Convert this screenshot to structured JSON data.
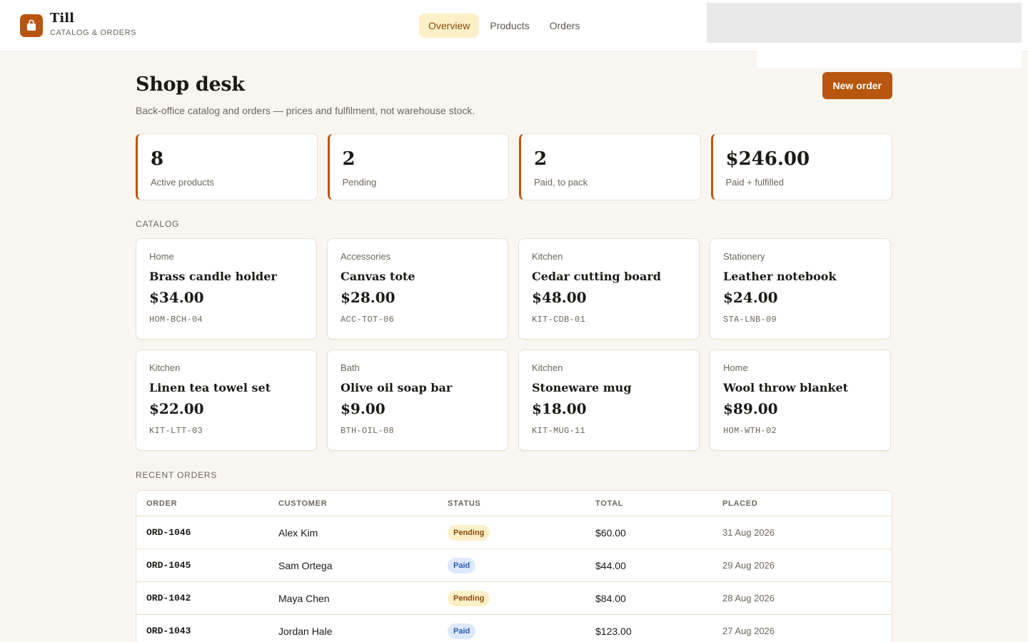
{
  "app": {
    "name": "Till",
    "subtitle": "CATALOG & ORDERS",
    "accent_color": "#b8560f",
    "logo_icon": "shopping-bag-icon"
  },
  "nav": {
    "items": [
      {
        "label": "Overview",
        "active": true
      },
      {
        "label": "Products",
        "active": false
      },
      {
        "label": "Orders",
        "active": false
      }
    ]
  },
  "page": {
    "title": "Shop desk",
    "subtitle": "Back-office catalog and orders — prices and fulfilment, not warehouse stock.",
    "new_order_label": "New order"
  },
  "stats": [
    {
      "value": "8",
      "label": "Active products"
    },
    {
      "value": "2",
      "label": "Pending"
    },
    {
      "value": "2",
      "label": "Paid, to pack"
    },
    {
      "value": "$246.00",
      "label": "Paid + fulfilled"
    }
  ],
  "catalog": {
    "label": "CATALOG",
    "products": [
      {
        "category": "Home",
        "name": "Brass candle holder",
        "price": "$34.00",
        "sku": "HOM-BCH-04"
      },
      {
        "category": "Accessories",
        "name": "Canvas tote",
        "price": "$28.00",
        "sku": "ACC-TOT-06"
      },
      {
        "category": "Kitchen",
        "name": "Cedar cutting board",
        "price": "$48.00",
        "sku": "KIT-CDB-01"
      },
      {
        "category": "Stationery",
        "name": "Leather notebook",
        "price": "$24.00",
        "sku": "STA-LNB-09"
      },
      {
        "category": "Kitchen",
        "name": "Linen tea towel set",
        "price": "$22.00",
        "sku": "KIT-LTT-03"
      },
      {
        "category": "Bath",
        "name": "Olive oil soap bar",
        "price": "$9.00",
        "sku": "BTH-OIL-08"
      },
      {
        "category": "Kitchen",
        "name": "Stoneware mug",
        "price": "$18.00",
        "sku": "KIT-MUG-11"
      },
      {
        "category": "Home",
        "name": "Wool throw blanket",
        "price": "$89.00",
        "sku": "HOM-WTH-02"
      }
    ]
  },
  "orders": {
    "label": "RECENT ORDERS",
    "columns": [
      "ORDER",
      "CUSTOMER",
      "STATUS",
      "TOTAL",
      "PLACED"
    ],
    "rows": [
      {
        "id": "ORD-1046",
        "customer": "Alex Kim",
        "status": "Pending",
        "total": "$60.00",
        "placed": "31 Aug 2026"
      },
      {
        "id": "ORD-1045",
        "customer": "Sam Ortega",
        "status": "Paid",
        "total": "$44.00",
        "placed": "29 Aug 2026"
      },
      {
        "id": "ORD-1042",
        "customer": "Maya Chen",
        "status": "Pending",
        "total": "$84.00",
        "placed": "28 Aug 2026"
      },
      {
        "id": "ORD-1043",
        "customer": "Jordan Hale",
        "status": "Paid",
        "total": "$123.00",
        "placed": "27 Aug 2026"
      }
    ]
  }
}
